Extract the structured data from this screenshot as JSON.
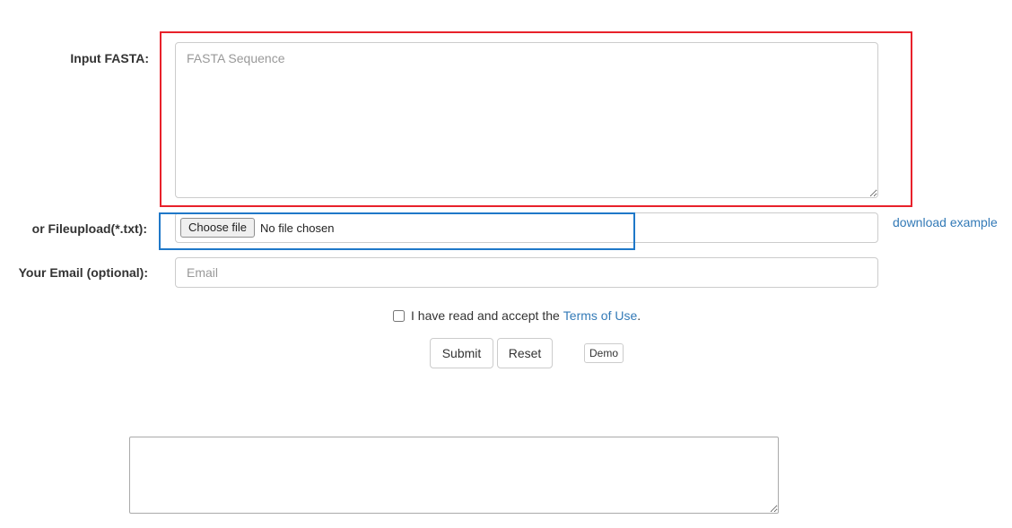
{
  "form": {
    "fasta_label": "Input FASTA:",
    "fasta_placeholder": "FASTA Sequence",
    "fasta_value": "",
    "upload_label": "or Fileupload(*.txt):",
    "choose_file_label": "Choose file",
    "file_status": "No file chosen",
    "download_example": "download example",
    "email_label": "Your Email (optional):",
    "email_placeholder": "Email",
    "email_value": "",
    "terms_text": "I have read and accept the",
    "terms_link": "Terms of Use",
    "terms_period": ".",
    "terms_checked": false
  },
  "buttons": {
    "submit": "Submit",
    "reset": "Reset",
    "demo": "Demo"
  },
  "output": {
    "value": ""
  },
  "colors": {
    "link": "#337ab7",
    "highlight_fasta": "#e8212b",
    "highlight_upload": "#1f78c8"
  }
}
